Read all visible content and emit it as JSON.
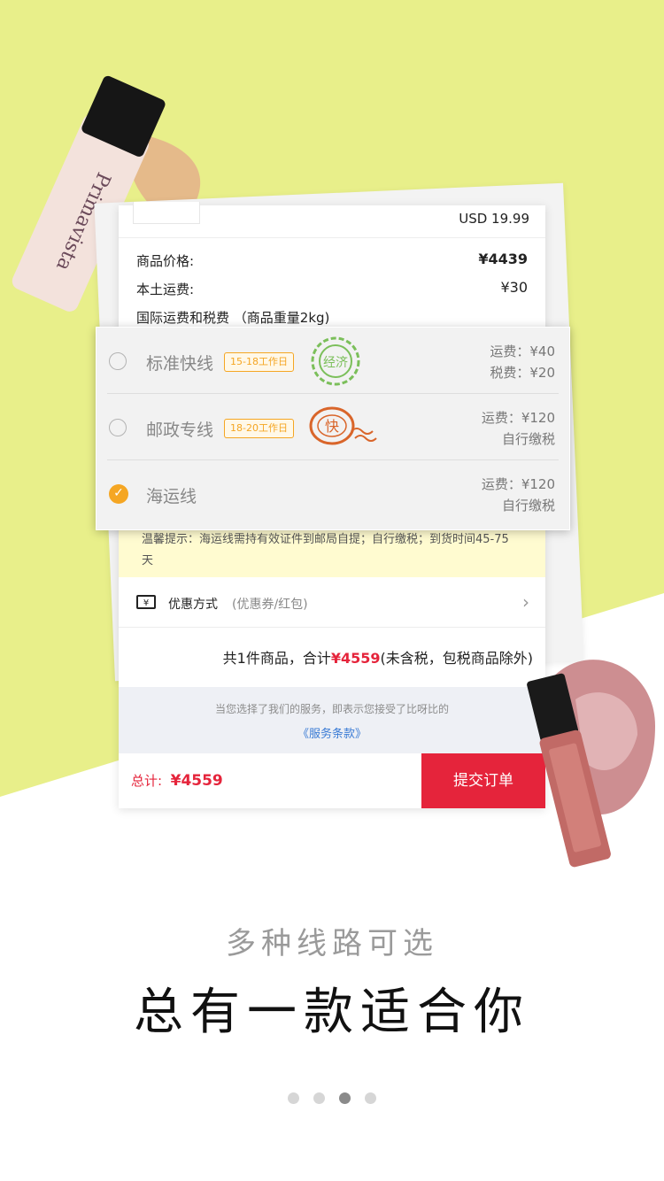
{
  "colors": {
    "bg_yellow": "#e8ef8a",
    "accent_red": "#e5243b",
    "accent_orange": "#f5a623",
    "stamp_green": "#7bbf5a",
    "stamp_orange": "#d9652a"
  },
  "order": {
    "usd_price": "USD 19.99",
    "rows": [
      {
        "label": "商品价格:",
        "value": "¥4439"
      },
      {
        "label": "本土运费:",
        "value": "¥30"
      },
      {
        "label": "国际运费和税费 （商品重量2kg)",
        "value": ""
      }
    ],
    "notice": "温馨提示：海运线需持有效证件到邮局自提；自行缴税；到货时间45-75天",
    "coupon_label": "优惠方式",
    "coupon_sub": "(优惠券/红包)",
    "summary_prefix": "共1件商品，合计",
    "summary_amount": "¥4559",
    "summary_suffix": "(未含税，包税商品除外)",
    "terms_text": "当您选择了我们的服务，即表示您接受了比呀比的",
    "terms_link": "《服务条款》",
    "total_label": "总计:",
    "total_amount": "¥4559",
    "submit_label": "提交订单"
  },
  "shipping_options": [
    {
      "name": "标准快线",
      "badge": "15-18工作日",
      "line1": "运费：¥40",
      "line2": "税费：¥20",
      "selected": false,
      "stamp": "经济"
    },
    {
      "name": "邮政专线",
      "badge": "18-20工作日",
      "line1": "运费：¥120",
      "line2": "自行缴税",
      "selected": false,
      "stamp": "快"
    },
    {
      "name": "海运线",
      "badge": "",
      "line1": "运费：¥120",
      "line2": "自行缴税",
      "selected": true,
      "stamp": ""
    }
  ],
  "product_left_label": "Primavista",
  "caption_sub": "多种线路可选",
  "caption_main": "总有一款适合你",
  "pager": {
    "count": 4,
    "active_index": 3
  }
}
